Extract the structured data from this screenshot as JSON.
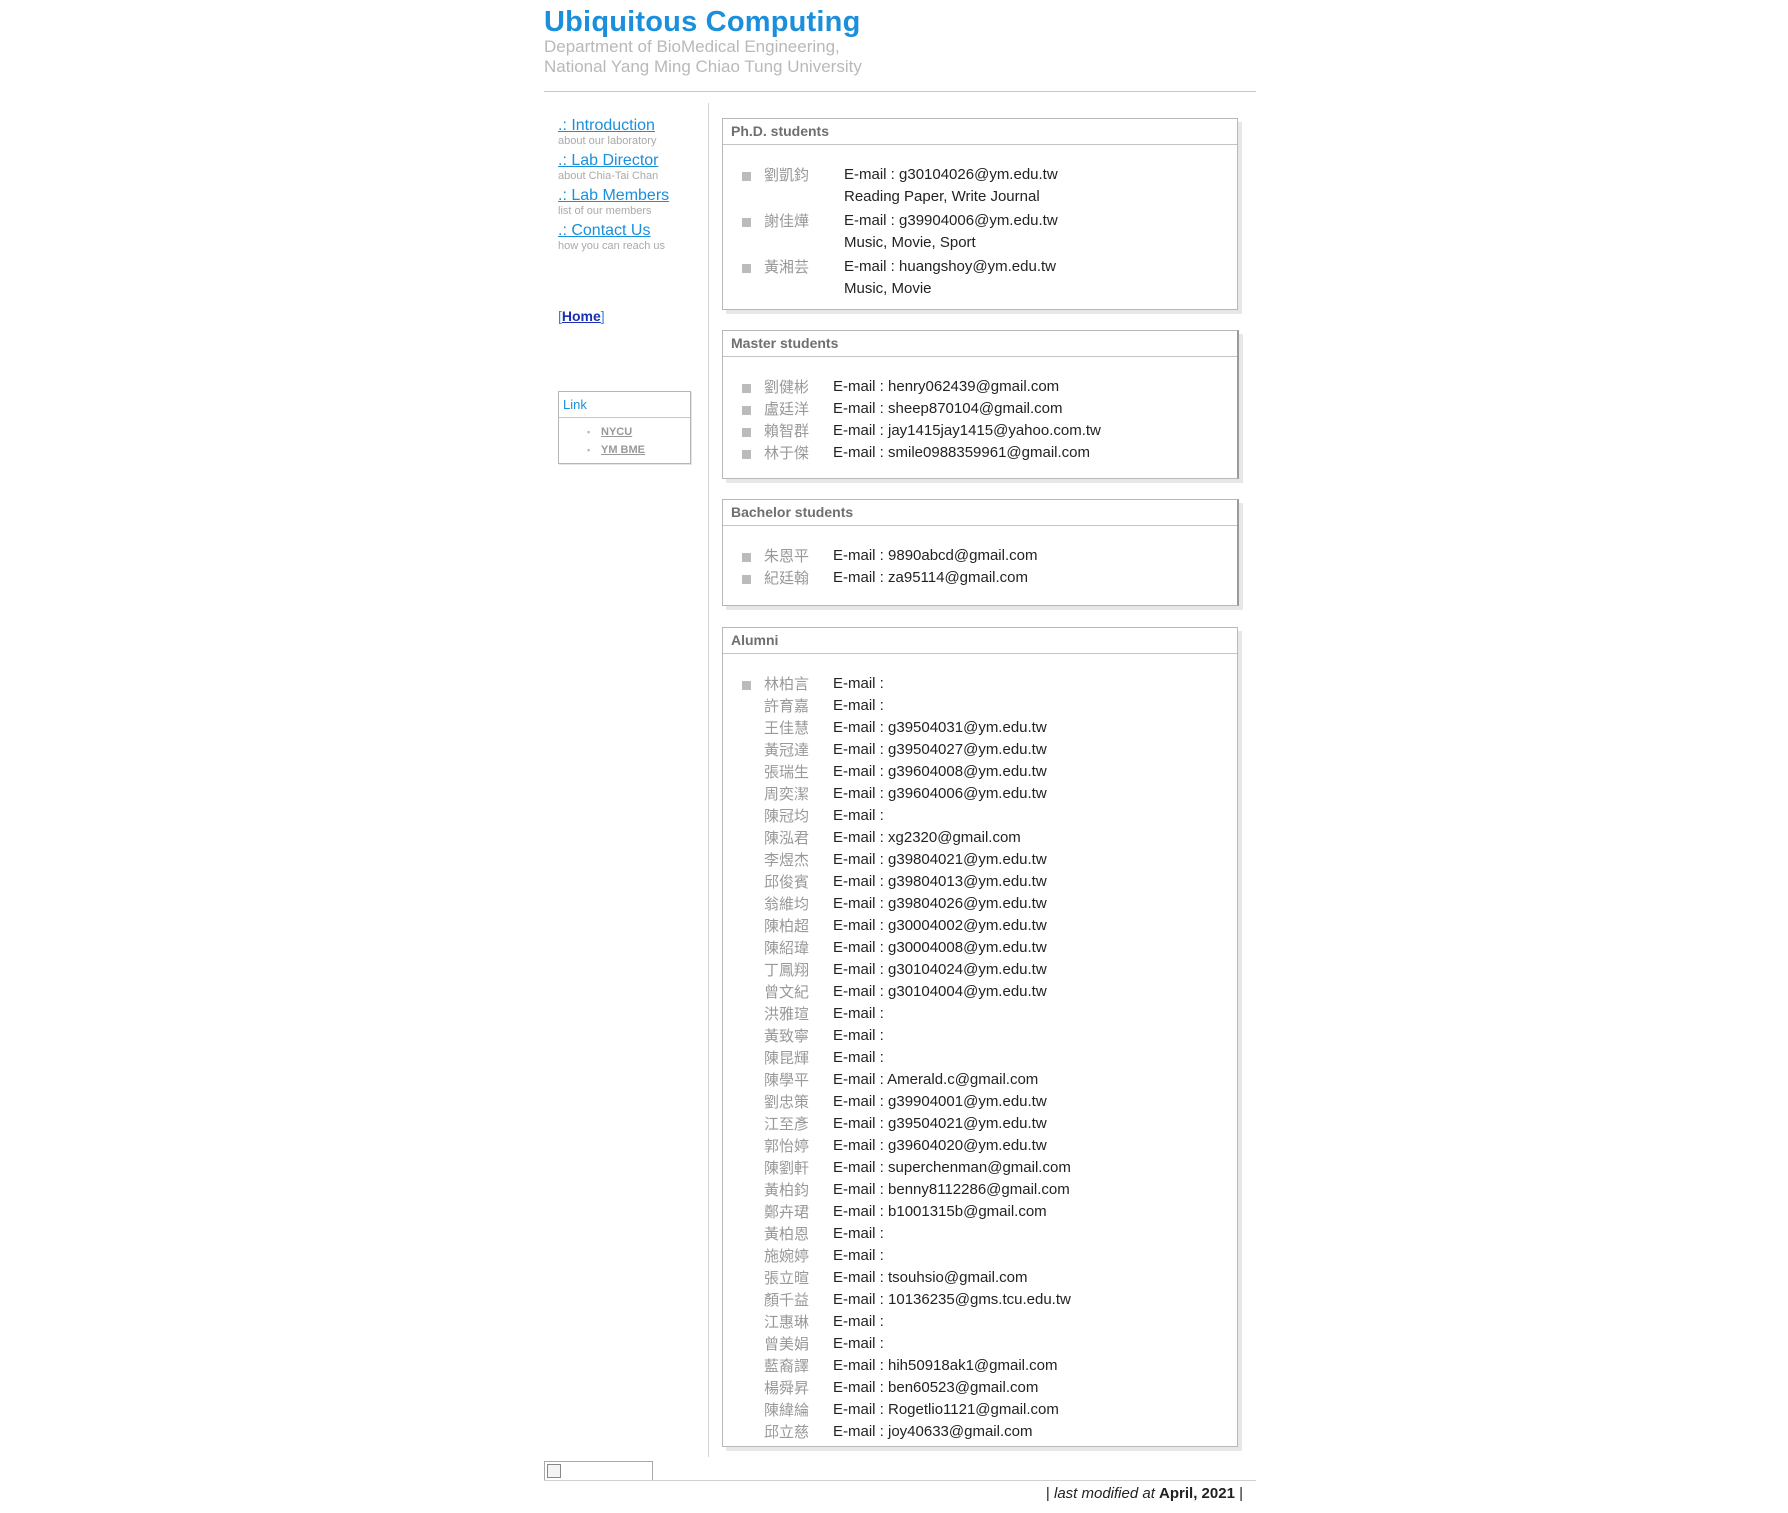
{
  "header": {
    "title": "Ubiquitous Computing",
    "dept_line1": "Department of BioMedical Engineering,",
    "dept_line2": "National Yang Ming Chiao Tung University"
  },
  "sidebar": {
    "items": [
      {
        "label": ".: Introduction",
        "sub": "about our laboratory"
      },
      {
        "label": ".: Lab Director",
        "sub": "about Chia-Tai Chan"
      },
      {
        "label": ".: Lab Members",
        "sub": "list of our members"
      },
      {
        "label": ".: Contact Us",
        "sub": "how you can reach us"
      }
    ],
    "home_open": "[",
    "home_label": "Home",
    "home_close": "]",
    "link_box": {
      "title": "Link",
      "links": [
        "NYCU",
        "YM BME"
      ]
    }
  },
  "phd": {
    "title": "Ph.D. students",
    "rows": [
      {
        "name": "劉凱鈞",
        "email": "E-mail : g30104026@ym.edu.tw",
        "note": "Reading Paper, Write Journal"
      },
      {
        "name": "謝佳燁",
        "email": "E-mail : g39904006@ym.edu.tw",
        "note": "Music, Movie, Sport"
      },
      {
        "name": "黃湘芸",
        "email": "E-mail : huangshoy@ym.edu.tw",
        "note": "Music, Movie"
      }
    ]
  },
  "master": {
    "title": "Master students",
    "rows": [
      {
        "name": "劉健彬",
        "email": "E-mail : henry062439@gmail.com"
      },
      {
        "name": "盧廷洋",
        "email": "E-mail : sheep870104@gmail.com"
      },
      {
        "name": "賴智群",
        "email": "E-mail : jay1415jay1415@yahoo.com.tw"
      },
      {
        "name": "林于傑",
        "email": "E-mail : smile0988359961@gmail.com"
      }
    ]
  },
  "bachelor": {
    "title": "Bachelor students",
    "rows": [
      {
        "name": "朱恩平",
        "email": "E-mail : 9890abcd@gmail.com"
      },
      {
        "name": "紀廷翰",
        "email": "E-mail : za95114@gmail.com"
      }
    ]
  },
  "alumni": {
    "title": "Alumni",
    "rows": [
      {
        "name": "林柏言",
        "email": "E-mail :"
      },
      {
        "name": "許育嘉",
        "email": "E-mail :"
      },
      {
        "name": "王佳慧",
        "email": "E-mail : g39504031@ym.edu.tw"
      },
      {
        "name": "黃冠達",
        "email": "E-mail : g39504027@ym.edu.tw"
      },
      {
        "name": "張瑞生",
        "email": "E-mail : g39604008@ym.edu.tw"
      },
      {
        "name": "周奕潔",
        "email": "E-mail : g39604006@ym.edu.tw"
      },
      {
        "name": "陳冠均",
        "email": "E-mail :"
      },
      {
        "name": "陳泓君",
        "email": "E-mail : xg2320@gmail.com"
      },
      {
        "name": "李煜杰",
        "email": "E-mail : g39804021@ym.edu.tw"
      },
      {
        "name": "邱俊賓",
        "email": "E-mail : g39804013@ym.edu.tw"
      },
      {
        "name": "翁維均",
        "email": "E-mail : g39804026@ym.edu.tw"
      },
      {
        "name": "陳柏超",
        "email": "E-mail : g30004002@ym.edu.tw"
      },
      {
        "name": "陳紹瑋",
        "email": "E-mail : g30004008@ym.edu.tw"
      },
      {
        "name": "丁鳳翔",
        "email": "E-mail : g30104024@ym.edu.tw"
      },
      {
        "name": "曾文紀",
        "email": "E-mail : g30104004@ym.edu.tw"
      },
      {
        "name": "洪雅瑄",
        "email": "E-mail :"
      },
      {
        "name": "黃致寧",
        "email": "E-mail :"
      },
      {
        "name": "陳昆輝",
        "email": "E-mail :"
      },
      {
        "name": "陳學平",
        "email": "E-mail : Amerald.c@gmail.com"
      },
      {
        "name": "劉忠策",
        "email": "E-mail : g39904001@ym.edu.tw"
      },
      {
        "name": "江至彥",
        "email": "E-mail : g39504021@ym.edu.tw"
      },
      {
        "name": "郭怡婷",
        "email": "E-mail : g39604020@ym.edu.tw"
      },
      {
        "name": "陳劉軒",
        "email": "E-mail : superchenman@gmail.com"
      },
      {
        "name": "黃柏鈞",
        "email": "E-mail : benny8112286@gmail.com"
      },
      {
        "name": "鄭卉珺",
        "email": "E-mail : b1001315b@gmail.com"
      },
      {
        "name": "黃柏恩",
        "email": "E-mail :"
      },
      {
        "name": "施婉婷",
        "email": "E-mail :"
      },
      {
        "name": "張立暄",
        "email": "E-mail : tsouhsio@gmail.com"
      },
      {
        "name": "顏千益",
        "email": "E-mail : 10136235@gms.tcu.edu.tw"
      },
      {
        "name": "江惠琳",
        "email": "E-mail :"
      },
      {
        "name": "曾美娟",
        "email": "E-mail :"
      },
      {
        "name": "藍裔譯",
        "email": "E-mail : hih50918ak1@gmail.com"
      },
      {
        "name": "楊舜昇",
        "email": "E-mail : ben60523@gmail.com"
      },
      {
        "name": "陳緯綸",
        "email": "E-mail : Rogetlio1121@gmail.com"
      },
      {
        "name": "邱立慈",
        "email": "E-mail : joy40633@gmail.com"
      }
    ]
  },
  "footer": {
    "pipe_left": "|",
    "text": "last modified at",
    "date": "April, 2021",
    "pipe_right": "|"
  }
}
